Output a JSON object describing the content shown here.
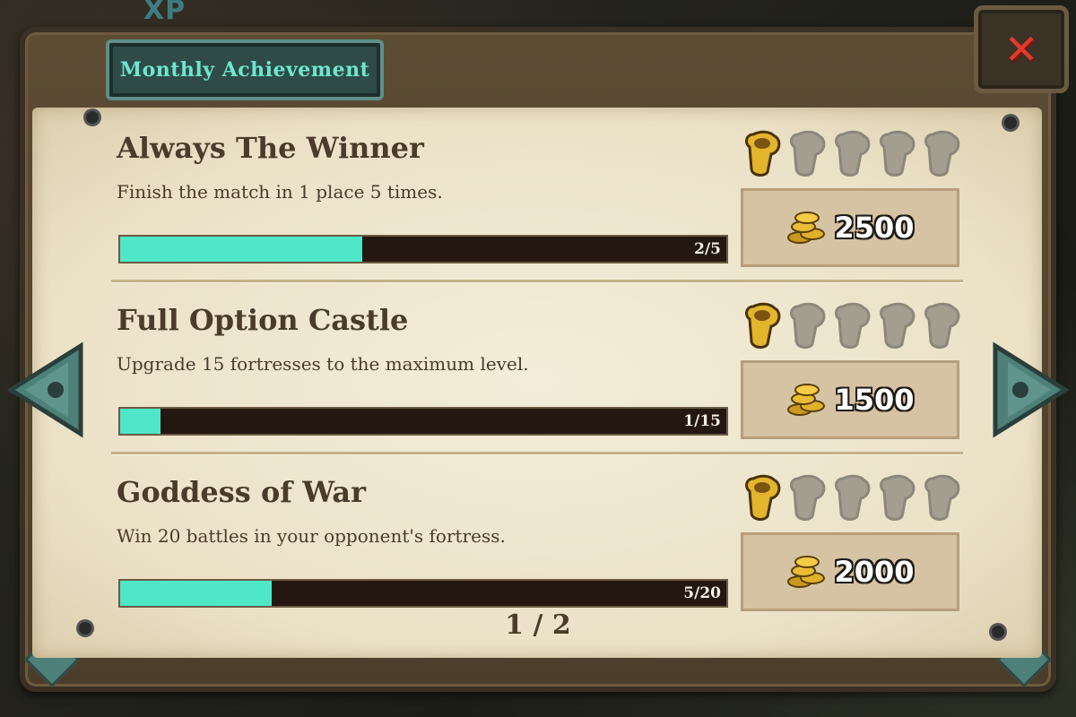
{
  "background": {
    "xp_label": "XP"
  },
  "header": {
    "title": "Monthly Achievement",
    "close_icon": "close-icon"
  },
  "achievements": [
    {
      "title": "Always The Winner",
      "description": "Finish the match in 1 place 5 times.",
      "progress_text": "2/5",
      "progress": 0.4,
      "medals_earned": 1,
      "medals_total": 5,
      "reward": "2500"
    },
    {
      "title": "Full Option Castle",
      "description": "Upgrade 15 fortresses to the maximum level.",
      "progress_text": "1/15",
      "progress": 0.0667,
      "medals_earned": 1,
      "medals_total": 5,
      "reward": "1500"
    },
    {
      "title": "Goddess of War",
      "description": "Win 20 battles in your opponent's fortress.",
      "progress_text": "5/20",
      "progress": 0.25,
      "medals_earned": 1,
      "medals_total": 5,
      "reward": "2000"
    }
  ],
  "pager": {
    "text": "1 / 2"
  },
  "colors": {
    "accent": "#4ee7c8",
    "title_tab_text": "#6ee6d0",
    "close_x": "#e23a2a",
    "ink": "#4a3b2b"
  }
}
